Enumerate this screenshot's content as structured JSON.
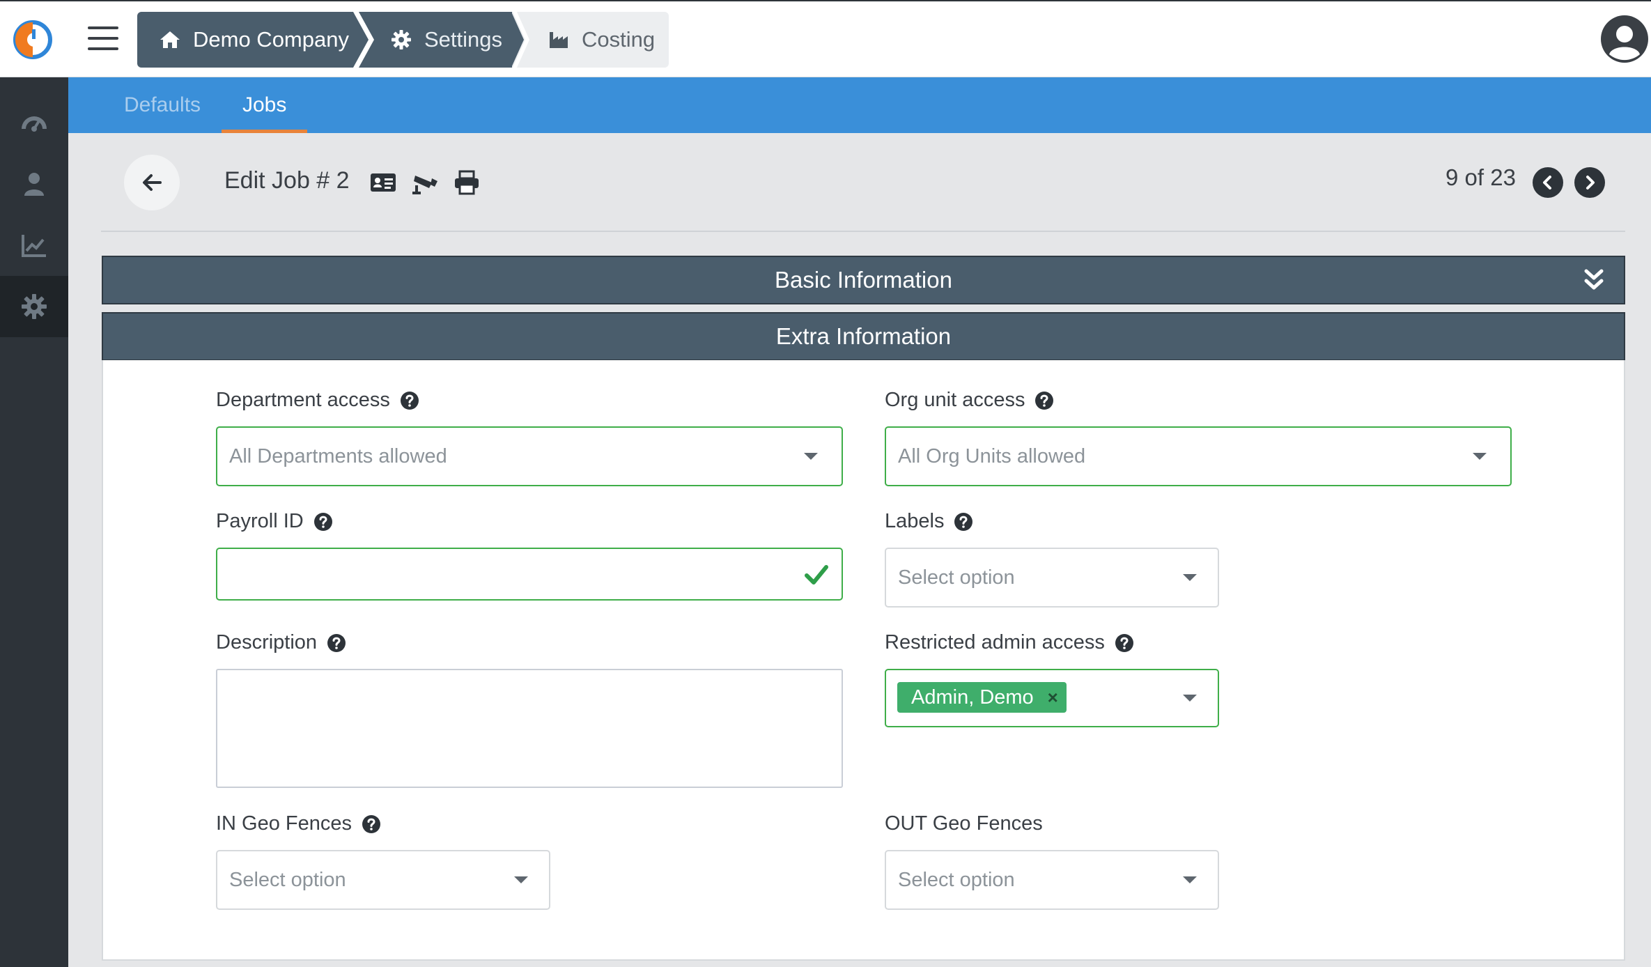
{
  "breadcrumbs": [
    {
      "label": "Demo Company",
      "icon": "home-icon"
    },
    {
      "label": "Settings",
      "icon": "gear-icon"
    },
    {
      "label": "Costing",
      "icon": "industry-icon"
    }
  ],
  "sidebar": {
    "items": [
      {
        "icon": "dashboard-icon"
      },
      {
        "icon": "employee-icon"
      },
      {
        "icon": "chart-icon"
      },
      {
        "icon": "settings-icon",
        "active": true
      }
    ]
  },
  "tabs": [
    {
      "label": "Defaults",
      "active": false
    },
    {
      "label": "Jobs",
      "active": true
    }
  ],
  "header": {
    "title": "Edit Job # 2",
    "pager": "9 of 23"
  },
  "panels": {
    "basic": "Basic Information",
    "extra": "Extra Information"
  },
  "form": {
    "department_access": {
      "label": "Department access",
      "value": "All Departments allowed"
    },
    "org_unit_access": {
      "label": "Org unit access",
      "value": "All Org Units allowed"
    },
    "payroll_id": {
      "label": "Payroll ID",
      "value": ""
    },
    "labels": {
      "label": "Labels",
      "placeholder": "Select option"
    },
    "description": {
      "label": "Description",
      "value": ""
    },
    "restricted_admin_access": {
      "label": "Restricted admin access",
      "tags": [
        "Admin, Demo"
      ],
      "remove": "×"
    },
    "in_geo_fences": {
      "label": "IN Geo Fences",
      "placeholder": "Select option"
    },
    "out_geo_fences": {
      "label": "OUT Geo Fences",
      "placeholder": "Select option"
    }
  },
  "colors": {
    "tab_bar": "#3a8fd9",
    "panel_header": "#4a5d6c",
    "valid_border": "#3fae49",
    "tag": "#3fae6b",
    "active_tab_underline": "#e8833a"
  }
}
